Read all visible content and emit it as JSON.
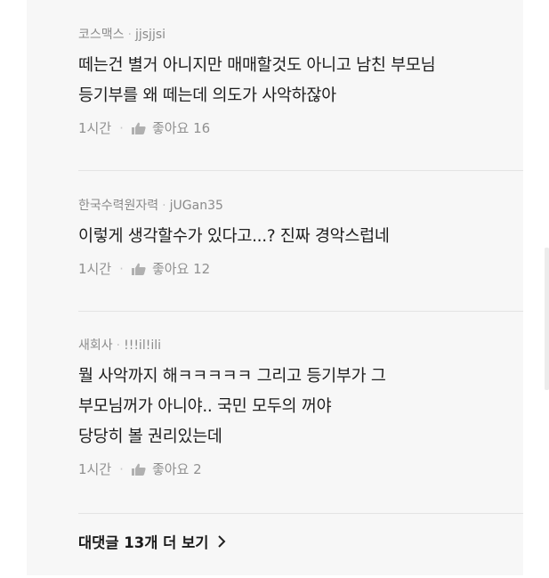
{
  "comments": [
    {
      "company": "코스맥스",
      "username": "jjsjjsi",
      "lines": [
        "떼는건 별거 아니지만 매매할것도 아니고 남친 부모님",
        "등기부를 왜 떼는데 의도가 사악하잖아"
      ],
      "time": "1시간",
      "like_label": "좋아요",
      "like_count": "16"
    },
    {
      "company": "한국수력원자력",
      "username": "jUGan35",
      "lines": [
        "이렇게 생각할수가 있다고...? 진짜 경악스럽네"
      ],
      "time": "1시간",
      "like_label": "좋아요",
      "like_count": "12"
    },
    {
      "company": "새회사",
      "username": "!!!il!ili",
      "lines": [
        "뭘 사악까지 해ㅋㅋㅋㅋㅋ 그리고 등기부가 그",
        "부모님꺼가 아니야.. 국민 모두의 꺼야",
        "당당히 볼 권리있는데"
      ],
      "time": "1시간",
      "like_label": "좋아요",
      "like_count": "2"
    }
  ],
  "more_replies": {
    "label": "대댓글 13개 더 보기"
  },
  "separator": "·",
  "icons": {
    "like": "thumbs-up-icon",
    "more": "chevron-right-icon"
  },
  "colors": {
    "text": "#1e1e1e",
    "meta": "#8a8a8a",
    "background": "#f7f7f7"
  }
}
